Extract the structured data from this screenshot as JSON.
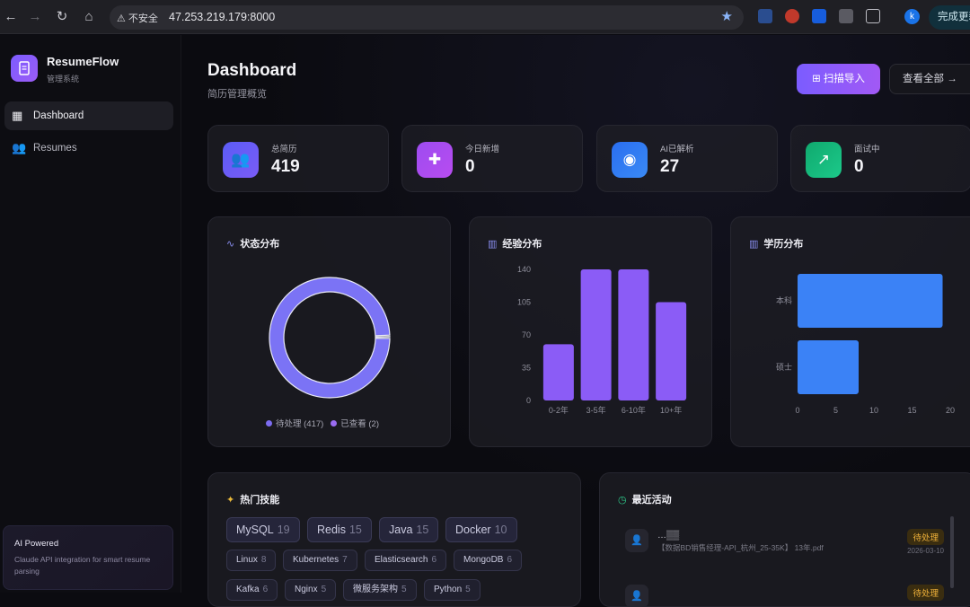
{
  "browser": {
    "warning": "不安全",
    "url": "47.253.219.179:8000",
    "update_label": "完成更新",
    "profile_initial": "k"
  },
  "sidebar": {
    "app_name": "ResumeFlow",
    "app_sub": "管理系统",
    "items": [
      {
        "label": "Dashboard",
        "active": true
      },
      {
        "label": "Resumes",
        "active": false
      }
    ],
    "ai_box": {
      "title": "AI Powered",
      "desc": "Claude API integration for smart resume parsing"
    }
  },
  "header": {
    "title": "Dashboard",
    "subtitle": "简历管理概览",
    "import_label": "扫描导入",
    "view_all_label": "查看全部"
  },
  "stats": [
    {
      "label": "总简历",
      "value": "419",
      "color": "#6d5cf6",
      "icon": "users-icon"
    },
    {
      "label": "今日新增",
      "value": "0",
      "color": "#a24df0",
      "icon": "user-plus-icon"
    },
    {
      "label": "AI已解析",
      "value": "27",
      "color": "#2f7bf0",
      "icon": "brain-icon"
    },
    {
      "label": "面试中",
      "value": "0",
      "color": "#16b87a",
      "icon": "trending-up-icon"
    }
  ],
  "charts": {
    "status_title": "状态分布",
    "experience_title": "经验分布",
    "education_title": "学历分布"
  },
  "chart_data": [
    {
      "type": "pie",
      "title": "状态分布",
      "labels": [
        "待处理",
        "已查看"
      ],
      "values": [
        417,
        2
      ],
      "legend_labels": [
        "待处理 (417)",
        "已查看 (2)"
      ],
      "colors": [
        "#7b73f5",
        "#8a63f0"
      ],
      "legend": "bottom"
    },
    {
      "type": "bar",
      "title": "经验分布",
      "categories": [
        "0-2年",
        "3-5年",
        "6-10年",
        "10+年"
      ],
      "values": [
        60,
        140,
        140,
        105
      ],
      "ylim": [
        0,
        140
      ],
      "yticks": [
        0,
        35,
        70,
        105,
        140
      ],
      "color": "#8b5cf6"
    },
    {
      "type": "bar",
      "orientation": "horizontal",
      "title": "学历分布",
      "categories": [
        "本科",
        "硕士"
      ],
      "values": [
        19,
        8
      ],
      "xlim": [
        0,
        20
      ],
      "xticks": [
        0,
        5,
        10,
        15,
        20
      ],
      "color": "#3b82f6"
    }
  ],
  "skills": {
    "title": "热门技能",
    "items": [
      {
        "name": "MySQL",
        "count": "19",
        "big": true
      },
      {
        "name": "Redis",
        "count": "15",
        "big": true
      },
      {
        "name": "Java",
        "count": "15",
        "big": true
      },
      {
        "name": "Docker",
        "count": "10",
        "big": true
      },
      {
        "name": "Linux",
        "count": "8",
        "big": false
      },
      {
        "name": "Kubernetes",
        "count": "7",
        "big": false
      },
      {
        "name": "Elasticsearch",
        "count": "6",
        "big": false
      },
      {
        "name": "MongoDB",
        "count": "6",
        "big": false
      },
      {
        "name": "Kafka",
        "count": "6",
        "big": false
      },
      {
        "name": "Nginx",
        "count": "5",
        "big": false
      },
      {
        "name": "微服务架构",
        "count": "5",
        "big": false
      },
      {
        "name": "Python",
        "count": "5",
        "big": false
      }
    ]
  },
  "activity": {
    "title": "最近活动",
    "items": [
      {
        "file": "【数据BD销售经理-API_杭州_25-35K】  13年.pdf",
        "status": "待处理",
        "date": "2026-03-10"
      },
      {
        "file": "",
        "status": "待处理",
        "date": ""
      }
    ]
  }
}
